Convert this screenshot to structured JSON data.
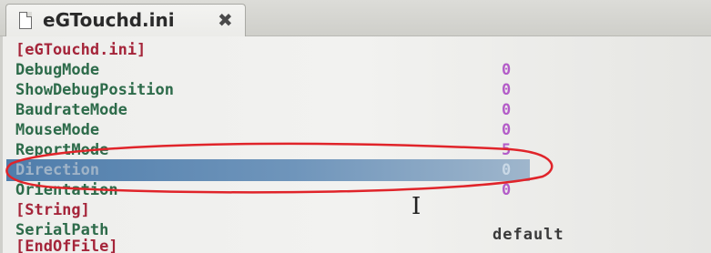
{
  "tab": {
    "title": "eGTouchd.ini",
    "close_label": "✖",
    "icon": "document-icon"
  },
  "lines": [
    {
      "text": "[eGTouchd.ini]",
      "kind": "section"
    },
    {
      "text": "DebugMode",
      "kind": "key",
      "value": "0"
    },
    {
      "text": "ShowDebugPosition",
      "kind": "key",
      "value": "0"
    },
    {
      "text": "BaudrateMode",
      "kind": "key",
      "value": "0"
    },
    {
      "text": "MouseMode",
      "kind": "key",
      "value": "0"
    },
    {
      "text": "ReportMode",
      "kind": "key",
      "value": "5"
    },
    {
      "text": "Direction",
      "kind": "key",
      "value": "0",
      "selected": true
    },
    {
      "text": "Orientation",
      "kind": "key",
      "value": "0"
    },
    {
      "text": "[String]",
      "kind": "section"
    },
    {
      "text": "SerialPath",
      "kind": "key",
      "value": "default"
    },
    {
      "text": "[EndOfFile]",
      "kind": "section"
    }
  ],
  "colors": {
    "section": "#a5253a",
    "key": "#2d6b4a",
    "number": "#b35cc8",
    "selection": "#4f7dab",
    "annotation": "#e0242a"
  }
}
